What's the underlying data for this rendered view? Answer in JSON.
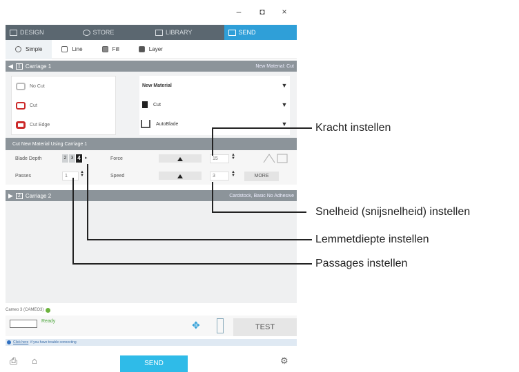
{
  "window": {
    "minimize": "–",
    "maximize": "◘",
    "close": "×"
  },
  "tabs": [
    {
      "label": "DESIGN"
    },
    {
      "label": "STORE"
    },
    {
      "label": "LIBRARY"
    },
    {
      "label": "SEND"
    }
  ],
  "modes": [
    {
      "label": "Simple"
    },
    {
      "label": "Line"
    },
    {
      "label": "Fill"
    },
    {
      "label": "Layer"
    }
  ],
  "carriage1": {
    "num": "1",
    "label": "Carriage 1",
    "right": "New Material: Cut"
  },
  "cut_options": [
    {
      "label": "No Cut"
    },
    {
      "label": "Cut"
    },
    {
      "label": "Cut Edge"
    }
  ],
  "material": {
    "name": "New Material",
    "action": "Cut",
    "tool": "AutoBlade"
  },
  "settings_header": "Cut New Material Using Carriage 1",
  "settings": {
    "blade_depth_label": "Blade Depth",
    "blade_values": [
      "2",
      "3",
      "4"
    ],
    "force_label": "Force",
    "force_value": "15",
    "passes_label": "Passes",
    "passes_value": "1",
    "speed_label": "Speed",
    "speed_value": "3",
    "more_label": "MORE"
  },
  "carriage2": {
    "num": "2",
    "label": "Carriage 2",
    "right": "Cardstock, Basic No Adhesive"
  },
  "status": {
    "device": "Cameo 3 (CAMEO3)",
    "ready": "Ready",
    "test": "TEST"
  },
  "info": {
    "link": "Click here",
    "text": "if you have trouble connecting"
  },
  "send": "SEND",
  "callouts": {
    "force": "Kracht instellen",
    "speed": "Snelheid (snijsnelheid) instellen",
    "depth": "Lemmetdiepte instellen",
    "passes": "Passages instellen"
  },
  "colors": {
    "accent": "#2f9fd8",
    "send": "#2fbbe8",
    "header": "#8c949a",
    "cut_red": "#cc2a2a"
  }
}
